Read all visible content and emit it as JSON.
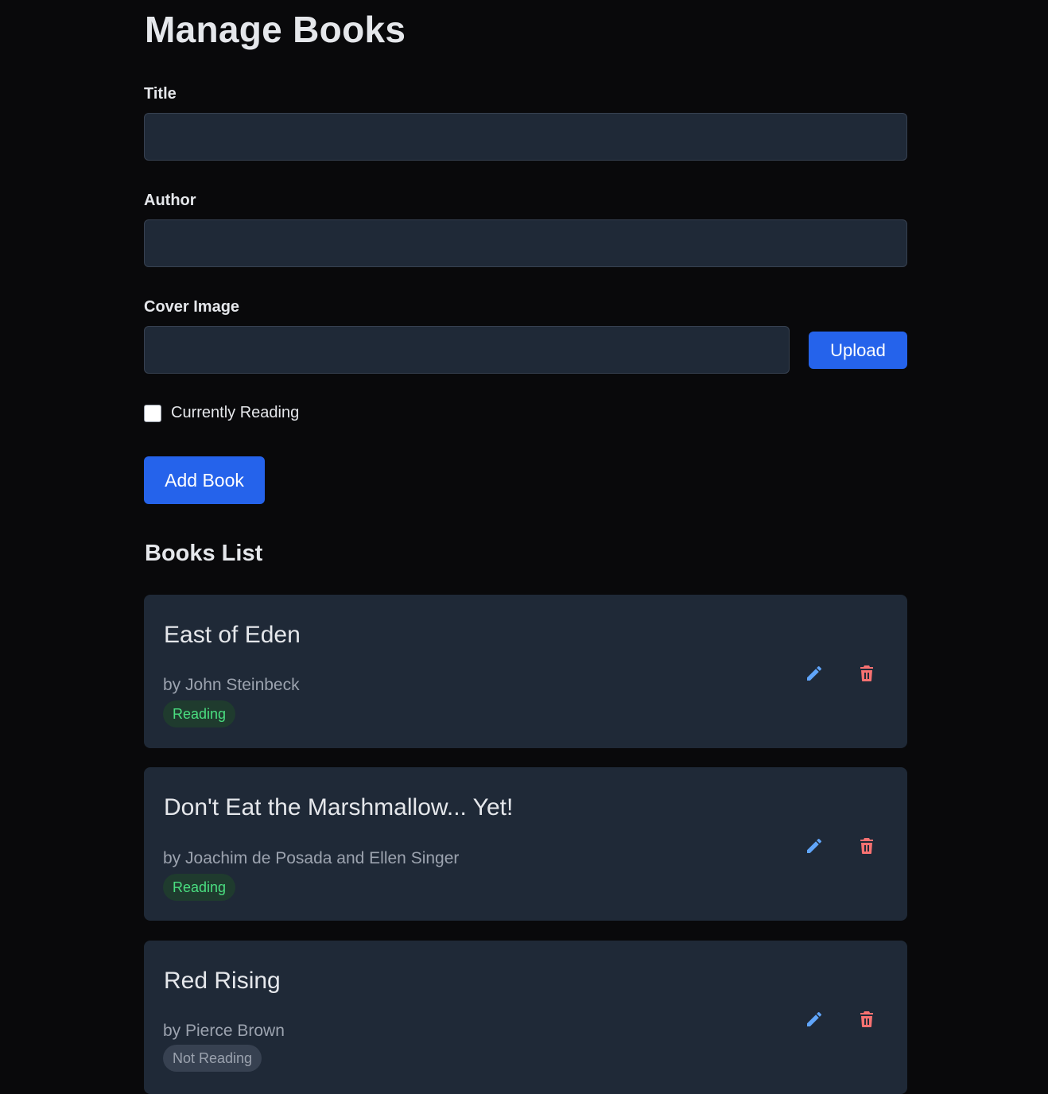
{
  "page": {
    "title": "Manage Books"
  },
  "form": {
    "title_label": "Title",
    "title_value": "",
    "author_label": "Author",
    "author_value": "",
    "cover_label": "Cover Image",
    "cover_value": "",
    "upload_label": "Upload",
    "checkbox_label": "Currently Reading",
    "checkbox_checked": false,
    "add_label": "Add Book"
  },
  "books_section": {
    "title": "Books List"
  },
  "books": [
    {
      "title": "East of Eden",
      "author": "by John Steinbeck",
      "status": "Reading"
    },
    {
      "title": "Don't Eat the Marshmallow... Yet!",
      "author": "by Joachim de Posada and Ellen Singer",
      "status": "Reading"
    },
    {
      "title": "Red Rising",
      "author": "by Pierce Brown",
      "status": "Not Reading"
    }
  ],
  "icons": {
    "edit": "pencil-icon",
    "delete": "trash-icon"
  },
  "colors": {
    "background": "#09090b",
    "surface": "#1f2937",
    "primary": "#2563eb",
    "edit_icon": "#60a5fa",
    "delete_icon": "#f87171",
    "reading_badge_text": "#4ade80",
    "not_reading_badge_text": "#9ca3af"
  }
}
